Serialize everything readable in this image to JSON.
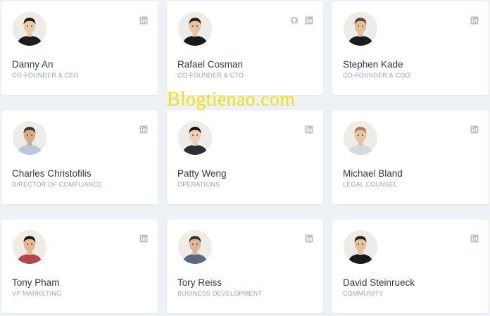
{
  "team": [
    {
      "name": "Danny An",
      "role": "CO-FOUNDER & CEO",
      "links": [
        "linkedin-icon"
      ],
      "avatar": {
        "skin": "#e8c9a8",
        "hair": "#1f1a17",
        "shirt": "#1d1d1f"
      }
    },
    {
      "name": "Rafael Cosman",
      "role": "CO-FOUNDER & CTO",
      "links": [
        "github-icon",
        "linkedin-icon"
      ],
      "avatar": {
        "skin": "#e6c3a2",
        "hair": "#2a1f18",
        "shirt": "#18191b"
      }
    },
    {
      "name": "Stephen Kade",
      "role": "CO-FOUNDER & COO",
      "links": [
        "linkedin-icon"
      ],
      "avatar": {
        "skin": "#e2bd9c",
        "hair": "#5a4634",
        "shirt": "#1b1b1d"
      }
    },
    {
      "name": "Charles Christofilis",
      "role": "DIRECTOR OF COMPLIANCE",
      "links": [
        "linkedin-icon"
      ],
      "avatar": {
        "skin": "#d8a98a",
        "hair": "#3b3530",
        "shirt": "#b9c7d8"
      }
    },
    {
      "name": "Patty Weng",
      "role": "OPERATIONS",
      "links": [
        "linkedin-icon"
      ],
      "avatar": {
        "skin": "#ecd0b6",
        "hair": "#141214",
        "shirt": "#2d2d33"
      }
    },
    {
      "name": "Michael Bland",
      "role": "LEGAL COUNSEL",
      "links": [
        "linkedin-icon"
      ],
      "avatar": {
        "skin": "#e4c2a4",
        "hair": "#a07e5e",
        "shirt": "#d5d9de"
      }
    },
    {
      "name": "Tony Pham",
      "role": "VP MARKETING",
      "links": [
        "linkedin-icon"
      ],
      "avatar": {
        "skin": "#e3b893",
        "hair": "#1d1915",
        "shirt": "#b0484e"
      }
    },
    {
      "name": "Tory Reiss",
      "role": "BUSINESS DEVELOPMENT",
      "links": [
        "linkedin-icon"
      ],
      "avatar": {
        "skin": "#dcb699",
        "hair": "#3e3128",
        "shirt": "#5e6a7a"
      }
    },
    {
      "name": "David Steinrueck",
      "role": "COMMUNITY",
      "links": [
        "linkedin-icon"
      ],
      "avatar": {
        "skin": "#e3c0a0",
        "hair": "#2b211b",
        "shirt": "#1a1a1c"
      }
    }
  ],
  "watermark": "Blogtienao.com",
  "colors": {
    "page_bg": "#eef2f7",
    "card_bg": "#ffffff",
    "name": "#2f3a48",
    "role": "#9aa4b1",
    "icon": "#b8c0ca",
    "watermark": "#f2e61a"
  }
}
